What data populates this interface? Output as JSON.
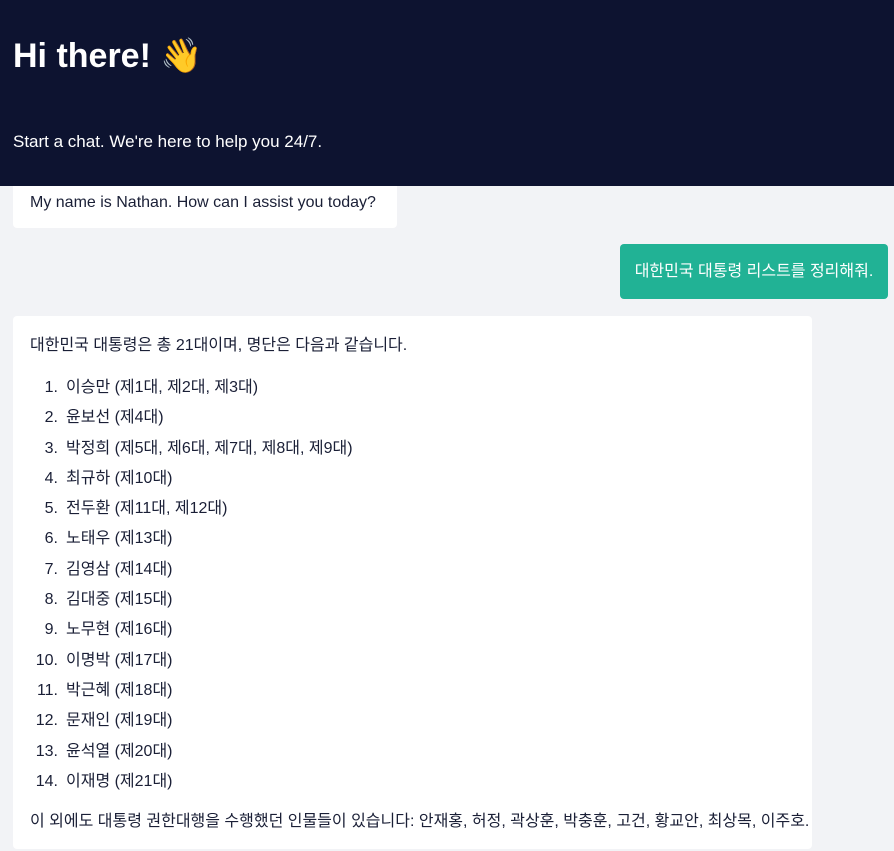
{
  "header": {
    "title": "Hi there! 👋",
    "subtitle": "Start a chat. We're here to help you 24/7."
  },
  "messages": {
    "bot_greeting": "My name is Nathan. How can I assist you today?",
    "user_request": "대한민국 대통령 리스트를 정리해줘.",
    "bot_answer": {
      "intro": "대한민국 대통령은 총 21대이며, 명단은 다음과 같습니다.",
      "items": [
        {
          "num": "1.",
          "text": "이승만 (제1대, 제2대, 제3대)"
        },
        {
          "num": "2.",
          "text": "윤보선 (제4대)"
        },
        {
          "num": "3.",
          "text": "박정희 (제5대, 제6대, 제7대, 제8대, 제9대)"
        },
        {
          "num": "4.",
          "text": "최규하 (제10대)"
        },
        {
          "num": "5.",
          "text": "전두환 (제11대, 제12대)"
        },
        {
          "num": "6.",
          "text": "노태우 (제13대)"
        },
        {
          "num": "7.",
          "text": "김영삼 (제14대)"
        },
        {
          "num": "8.",
          "text": "김대중 (제15대)"
        },
        {
          "num": "9.",
          "text": "노무현 (제16대)"
        },
        {
          "num": "10.",
          "text": "이명박 (제17대)"
        },
        {
          "num": "11.",
          "text": "박근혜 (제18대)"
        },
        {
          "num": "12.",
          "text": "문재인 (제19대)"
        },
        {
          "num": "13.",
          "text": "윤석열 (제20대)"
        },
        {
          "num": "14.",
          "text": "이재명 (제21대)"
        }
      ],
      "outro": "이 외에도 대통령 권한대행을 수행했던 인물들이 있습니다: 안재홍, 허정, 곽상훈, 박충훈, 고건, 황교안, 최상목, 이주호."
    }
  },
  "colors": {
    "header_bg": "#0d1330",
    "page_bg": "#f2f3f6",
    "user_bubble_bg": "#21b295",
    "bot_bubble_bg": "#ffffff",
    "text": "#1a1f36"
  }
}
